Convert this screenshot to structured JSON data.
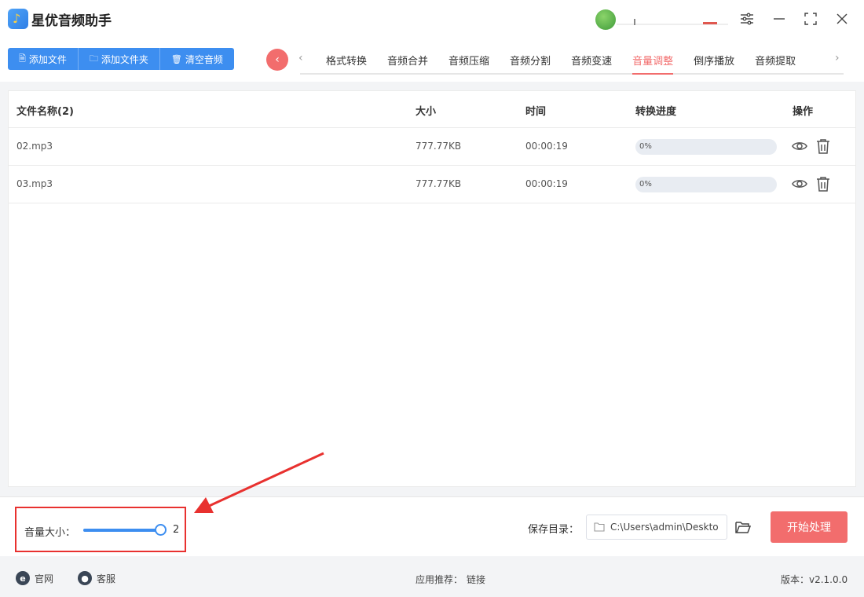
{
  "app": {
    "title": "星优音频助手"
  },
  "toolbar": {
    "add_file": "添加文件",
    "add_folder": "添加文件夹",
    "clear_audio": "清空音频"
  },
  "tabs": [
    {
      "label": "格式转换"
    },
    {
      "label": "音频合并"
    },
    {
      "label": "音频压缩"
    },
    {
      "label": "音频分割"
    },
    {
      "label": "音频变速"
    },
    {
      "label": "音量调整",
      "active": true
    },
    {
      "label": "倒序播放"
    },
    {
      "label": "音频提取"
    }
  ],
  "table": {
    "headers": {
      "name": "文件名称(2)",
      "size": "大小",
      "time": "时间",
      "progress": "转换进度",
      "actions": "操作"
    },
    "rows": [
      {
        "name": "02.mp3",
        "size": "777.77KB",
        "time": "00:00:19",
        "progress": "0%",
        "progress_value": 0
      },
      {
        "name": "03.mp3",
        "size": "777.77KB",
        "time": "00:00:19",
        "progress": "0%",
        "progress_value": 0
      }
    ]
  },
  "volume": {
    "label": "音量大小：",
    "value": "2"
  },
  "save": {
    "label": "保存目录：",
    "path": "C:\\Users\\admin\\Deskto"
  },
  "start_button": "开始处理",
  "footer": {
    "website": "官网",
    "support": "客服",
    "recommend_label": "应用推荐：",
    "recommend_link": "链接",
    "version": "版本：v2.1.0.0"
  },
  "colors": {
    "primary": "#3d8ef0",
    "accent": "#f26d6d",
    "highlight": "#e8312f"
  }
}
